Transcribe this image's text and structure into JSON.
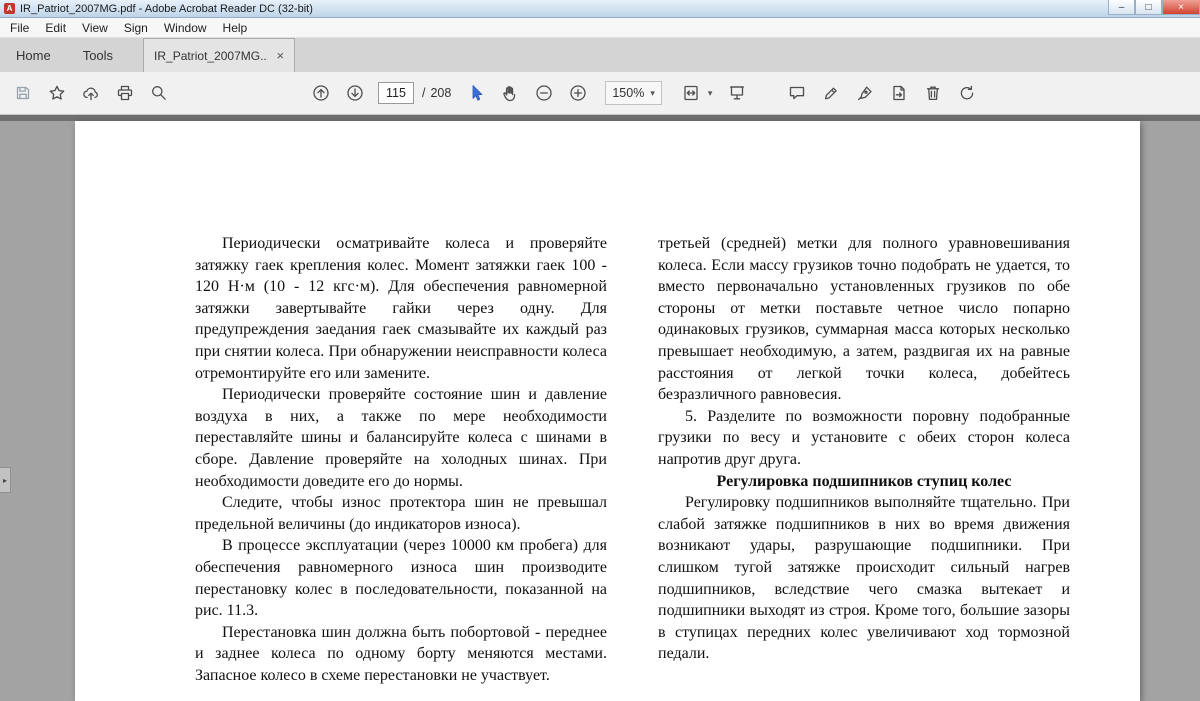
{
  "window": {
    "title": "IR_Patriot_2007MG.pdf - Adobe Acrobat Reader DC (32-bit)",
    "app_initial": "A"
  },
  "glyphs": {
    "win_min": "–",
    "win_max": "□",
    "win_close": "×",
    "tab_close": "×",
    "caret_down": "▾",
    "nav_pane_expand": "▸"
  },
  "menu_bar": {
    "items": [
      "File",
      "Edit",
      "View",
      "Sign",
      "Window",
      "Help"
    ]
  },
  "tab_bar": {
    "home_label": "Home",
    "tools_label": "Tools",
    "document_tab_label": "IR_Patriot_2007MG..."
  },
  "toolbar": {
    "page_current": "115",
    "page_divider": "/",
    "page_total": "208",
    "zoom_value": "150%"
  },
  "colors": {
    "titlebar_blue": "#bdd4e9",
    "select_tool_blue": "#3a6fd8",
    "doc_background_gray": "#a3a3a3",
    "page_white": "#ffffff"
  },
  "document": {
    "left_column": [
      "Периодически осматривайте колеса и проверяйте затяжку гаек крепления колес. Момент затяжки гаек 100 - 120 Н·м (10 - 12 кгс·м). Для обеспечения равномерной затяжки завертывайте гайки через одну. Для предупреждения заедания гаек смазывайте их каждый раз при снятии колеса. При обнаружении неисправности колеса отремонтируйте его или замените.",
      "Периодически проверяйте состояние шин и давление воздуха в них, а также по мере необходимости переставляйте шины и балансируйте колеса с шинами в сборе. Давление проверяйте на холодных шинах. При необходимости доведите его до нормы.",
      "Следите, чтобы износ протектора шин не превышал предельной величины (до индикаторов износа).",
      "В процессе эксплуатации (через 10000 км пробега) для обеспечения равномерного износа шин производите перестановку колес в последовательности, показанной на рис. 11.3.",
      "Перестановка шин должна быть побортовой - переднее и заднее колеса по одному борту меняются местами. Запасное колесо в схеме перестановки не участвует."
    ],
    "right_column_before_heading": [
      "третьей (средней) метки для полного уравновешивания колеса. Если массу грузиков точно подобрать не удается, то вместо первоначально установленных грузиков по обе стороны от метки поставьте четное число попарно одинаковых грузиков, суммарная масса которых несколько превышает необходимую, а затем, раздвигая их на равные расстояния от легкой точки колеса, добейтесь безразличного равновесия.",
      "5. Разделите по возможности поровну подобранные грузики по весу и установите с обеих сторон колеса напротив друг друга."
    ],
    "section_heading": "Регулировка подшипников ступиц колес",
    "right_column_after_heading": [
      "Регулировку подшипников выполняйте тщательно. При слабой затяжке подшипников в них во время движения возникают удары, разрушающие подшипники. При слишком тугой затяжке происходит сильный нагрев подшипников, вследствие чего смазка вытекает и подшипники выходят из строя. Кроме того, большие зазоры в ступицах передних колес увеличивают ход тормозной педали."
    ]
  }
}
